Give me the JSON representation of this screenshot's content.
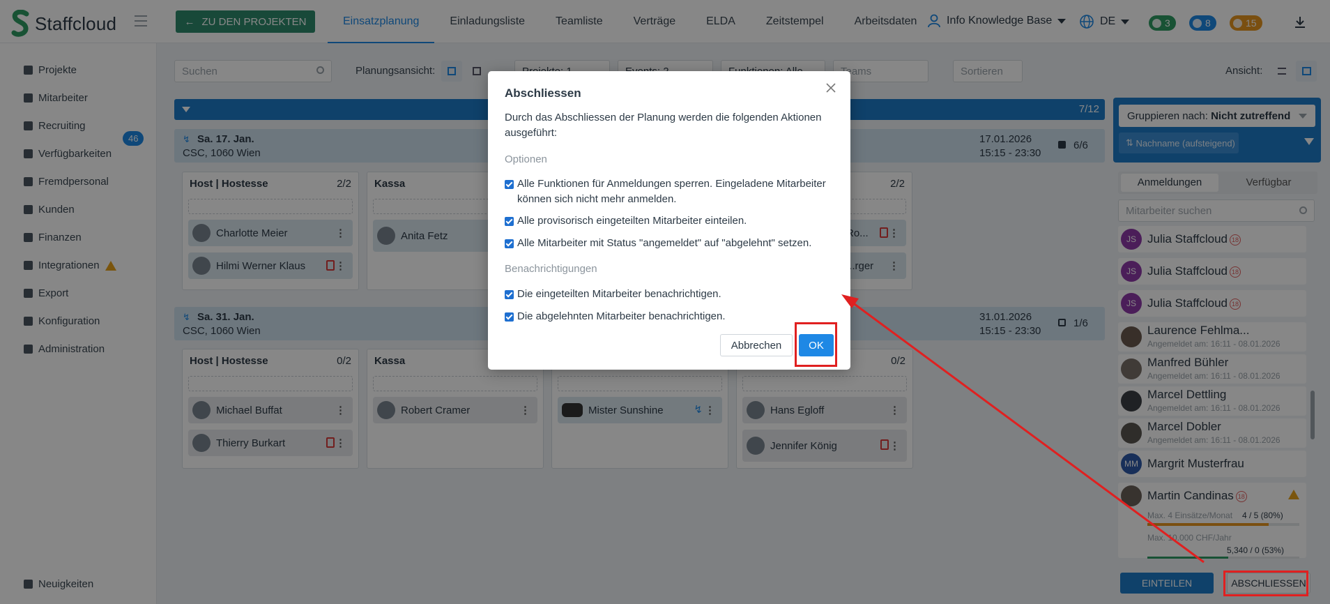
{
  "brand": {
    "name": "Staffcloud"
  },
  "topbar": {
    "back_label": "ZU DEN PROJEKTEN",
    "tabs": [
      "Einsatzplanung",
      "Einladungsliste",
      "Teamliste",
      "Verträge",
      "ELDA",
      "Zeitstempel",
      "Arbeitsdaten"
    ],
    "active_tab": "Einsatzplanung",
    "workspace": "Info Knowledge Base",
    "language": "DE",
    "badges": [
      {
        "icon": "chat-icon",
        "count": "3",
        "color": "#2e9b63"
      },
      {
        "icon": "bell-icon",
        "count": "8",
        "color": "#1e88e5"
      },
      {
        "icon": "clock-icon",
        "count": "15",
        "color": "#e6951f"
      }
    ]
  },
  "sidebar": {
    "items": [
      {
        "label": "Projekte"
      },
      {
        "label": "Mitarbeiter"
      },
      {
        "label": "Recruiting",
        "badge": "46"
      },
      {
        "label": "Verfügbarkeiten"
      },
      {
        "label": "Fremdpersonal"
      },
      {
        "label": "Kunden"
      },
      {
        "label": "Finanzen"
      },
      {
        "label": "Integrationen",
        "warning": true
      },
      {
        "label": "Export"
      },
      {
        "label": "Konfiguration"
      },
      {
        "label": "Administration"
      }
    ],
    "news": "Neuigkeiten"
  },
  "toolbar": {
    "search_placeholder": "Suchen",
    "planning_view_label": "Planungsansicht:",
    "projects_filter": "Projekte: 1",
    "events_filter": "Events: 2",
    "functions_filter": "Funktionen: Alle",
    "teams_placeholder": "Teams",
    "sort_placeholder": "Sortieren",
    "view_label": "Ansicht:"
  },
  "planning": {
    "progress": "7/12",
    "events": [
      {
        "date": "Sa. 17. Jan.",
        "location": "CSC, 1060 Wien",
        "end_date": "17.01.2026",
        "time": "15:15 - 23:30",
        "count": "6/6",
        "functions": [
          {
            "title": "Host | Hostesse",
            "count": "2/2",
            "people": [
              "Charlotte Meier",
              "Hilmi Werner Klaus"
            ]
          },
          {
            "title": "Kassa",
            "count": "",
            "people": [
              "Anita Fetz"
            ]
          },
          {
            "title": "",
            "count": "",
            "people": []
          },
          {
            "title": "",
            "count": "2/2",
            "people": [
              "Ro...",
              "...rger"
            ]
          }
        ]
      },
      {
        "date": "Sa. 31. Jan.",
        "location": "CSC, 1060 Wien",
        "end_date": "31.01.2026",
        "time": "15:15 - 23:30",
        "count": "1/6",
        "functions": [
          {
            "title": "Host | Hostesse",
            "count": "0/2",
            "people": [
              "Michael Buffat",
              "Thierry Burkart"
            ]
          },
          {
            "title": "Kassa",
            "count": "",
            "people": [
              "Robert Cramer"
            ]
          },
          {
            "title": "",
            "count": "",
            "people": [
              "Mister Sunshine"
            ]
          },
          {
            "title": "",
            "count": "0/2",
            "people": [
              "Hans Egloff",
              "Jennifer König"
            ]
          }
        ]
      }
    ]
  },
  "right_panel": {
    "group_label": "Gruppieren nach:",
    "group_value": "Nicht zutreffend",
    "sort_chip": "Nachname (aufsteigend)",
    "tabs": [
      "Anmeldungen",
      "Verfügbar"
    ],
    "search_placeholder": "Mitarbeiter suchen",
    "employees": [
      {
        "name": "Julia Staffcloud",
        "initials": "JS",
        "age": "18"
      },
      {
        "name": "Julia Staffcloud",
        "initials": "JS",
        "age": "18"
      },
      {
        "name": "Julia Staffcloud",
        "initials": "JS",
        "age": "18"
      },
      {
        "name": "Laurence Fehlma...",
        "sub": "Angemeldet am: 16:11 - 08.01.2026"
      },
      {
        "name": "Manfred Bühler",
        "sub": "Angemeldet am: 16:11 - 08.01.2026"
      },
      {
        "name": "Marcel Dettling",
        "sub": "Angemeldet am: 16:11 - 08.01.2026"
      },
      {
        "name": "Marcel Dobler",
        "sub": "Angemeldet am: 16:11 - 08.01.2026"
      },
      {
        "name": "Margrit Musterfrau",
        "initials": "MM"
      },
      {
        "name": "Martin Candinas",
        "age": "18",
        "limit1_label": "Max. 4 Einsätze/Monat",
        "limit1_value": "4 / 5 (80%)",
        "limit1_progress": 0.8,
        "limit2_label": "Max. 10.000 CHF/Jahr",
        "limit2_value": "5,340 / 0 (53%)",
        "limit2_progress": 0.53
      }
    ],
    "assign_button": "EINTEILEN",
    "close_button": "ABSCHLIESSEN"
  },
  "modal": {
    "title": "Abschliessen",
    "intro": "Durch das Abschliessen der Planung werden die folgenden Aktionen ausgeführt:",
    "options_heading": "Optionen",
    "options": [
      "Alle Funktionen für Anmeldungen sperren. Eingeladene Mitarbeiter können sich nicht mehr anmelden.",
      "Alle provisorisch eingeteilten Mitarbeiter einteilen.",
      "Alle Mitarbeiter mit Status \"angemeldet\" auf \"abgelehnt\" setzen."
    ],
    "notifications_heading": "Benachrichtigungen",
    "notifications": [
      "Die eingeteilten Mitarbeiter benachrichtigen.",
      "Die abgelehnten Mitarbeiter benachrichtigen."
    ],
    "cancel_label": "Abbrechen",
    "ok_label": "OK"
  }
}
